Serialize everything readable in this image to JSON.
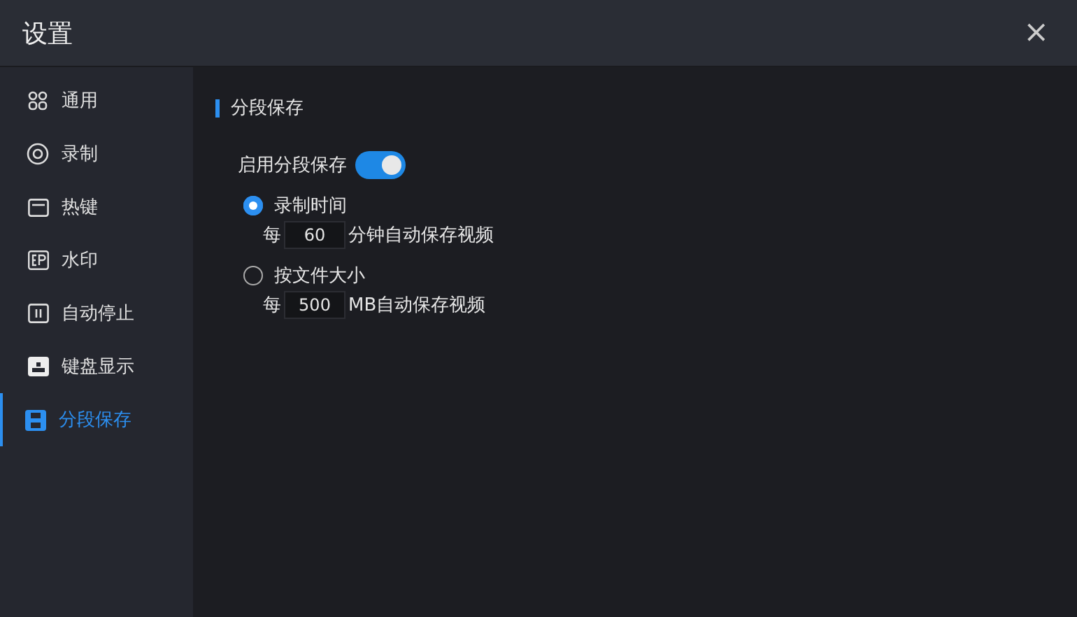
{
  "window": {
    "title": "设置",
    "close": "×"
  },
  "sidebar": {
    "items": [
      {
        "label": "通用",
        "selected": false
      },
      {
        "label": "录制",
        "selected": false
      },
      {
        "label": "热键",
        "selected": false
      },
      {
        "label": "水印",
        "selected": false
      },
      {
        "label": "自动停止",
        "selected": false
      },
      {
        "label": "键盘显示",
        "selected": false
      },
      {
        "label": "分段保存",
        "selected": true
      }
    ]
  },
  "section": {
    "title": "分段保存",
    "toggle": {
      "label": "启用分段保存",
      "on": true
    },
    "options": [
      {
        "label": "录制时间",
        "selected": true,
        "prefix": "每",
        "value": "60",
        "suffix": "分钟自动保存视频"
      },
      {
        "label": "按文件大小",
        "selected": false,
        "prefix": "每",
        "value": "500",
        "suffix": "MB自动保存视频"
      }
    ]
  }
}
